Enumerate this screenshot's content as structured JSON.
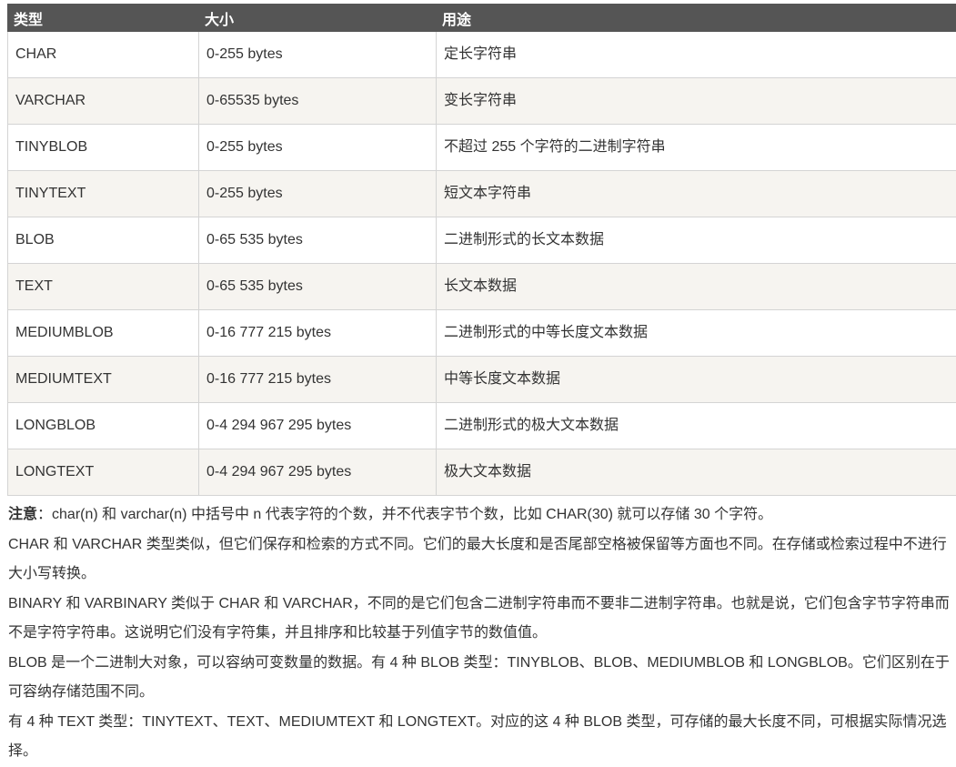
{
  "table": {
    "headers": [
      "类型",
      "大小",
      "用途"
    ],
    "rows": [
      [
        "CHAR",
        "0-255 bytes",
        "定长字符串"
      ],
      [
        "VARCHAR",
        "0-65535 bytes",
        "变长字符串"
      ],
      [
        "TINYBLOB",
        "0-255 bytes",
        "不超过 255 个字符的二进制字符串"
      ],
      [
        "TINYTEXT",
        "0-255 bytes",
        "短文本字符串"
      ],
      [
        "BLOB",
        "0-65 535 bytes",
        "二进制形式的长文本数据"
      ],
      [
        "TEXT",
        "0-65 535 bytes",
        "长文本数据"
      ],
      [
        "MEDIUMBLOB",
        "0-16 777 215 bytes",
        "二进制形式的中等长度文本数据"
      ],
      [
        "MEDIUMTEXT",
        "0-16 777 215 bytes",
        "中等长度文本数据"
      ],
      [
        "LONGBLOB",
        "0-4 294 967 295 bytes",
        "二进制形式的极大文本数据"
      ],
      [
        "LONGTEXT",
        "0-4 294 967 295 bytes",
        "极大文本数据"
      ]
    ]
  },
  "notes": {
    "note_label": "注意",
    "note_text": "：char(n) 和 varchar(n) 中括号中 n 代表字符的个数，并不代表字节个数，比如 CHAR(30) 就可以存储 30 个字符。",
    "paragraphs": [
      "CHAR 和 VARCHAR 类型类似，但它们保存和检索的方式不同。它们的最大长度和是否尾部空格被保留等方面也不同。在存储或检索过程中不进行大小写转换。",
      "BINARY 和 VARBINARY 类似于 CHAR 和 VARCHAR，不同的是它们包含二进制字符串而不要非二进制字符串。也就是说，它们包含字节字符串而不是字符字符串。这说明它们没有字符集，并且排序和比较基于列值字节的数值值。",
      "BLOB 是一个二进制大对象，可以容纳可变数量的数据。有 4 种 BLOB 类型：TINYBLOB、BLOB、MEDIUMBLOB 和 LONGBLOB。它们区别在于可容纳存储范围不同。",
      "有 4 种 TEXT 类型：TINYTEXT、TEXT、MEDIUMTEXT 和 LONGTEXT。对应的这 4 种 BLOB 类型，可存储的最大长度不同，可根据实际情况选择。"
    ]
  }
}
